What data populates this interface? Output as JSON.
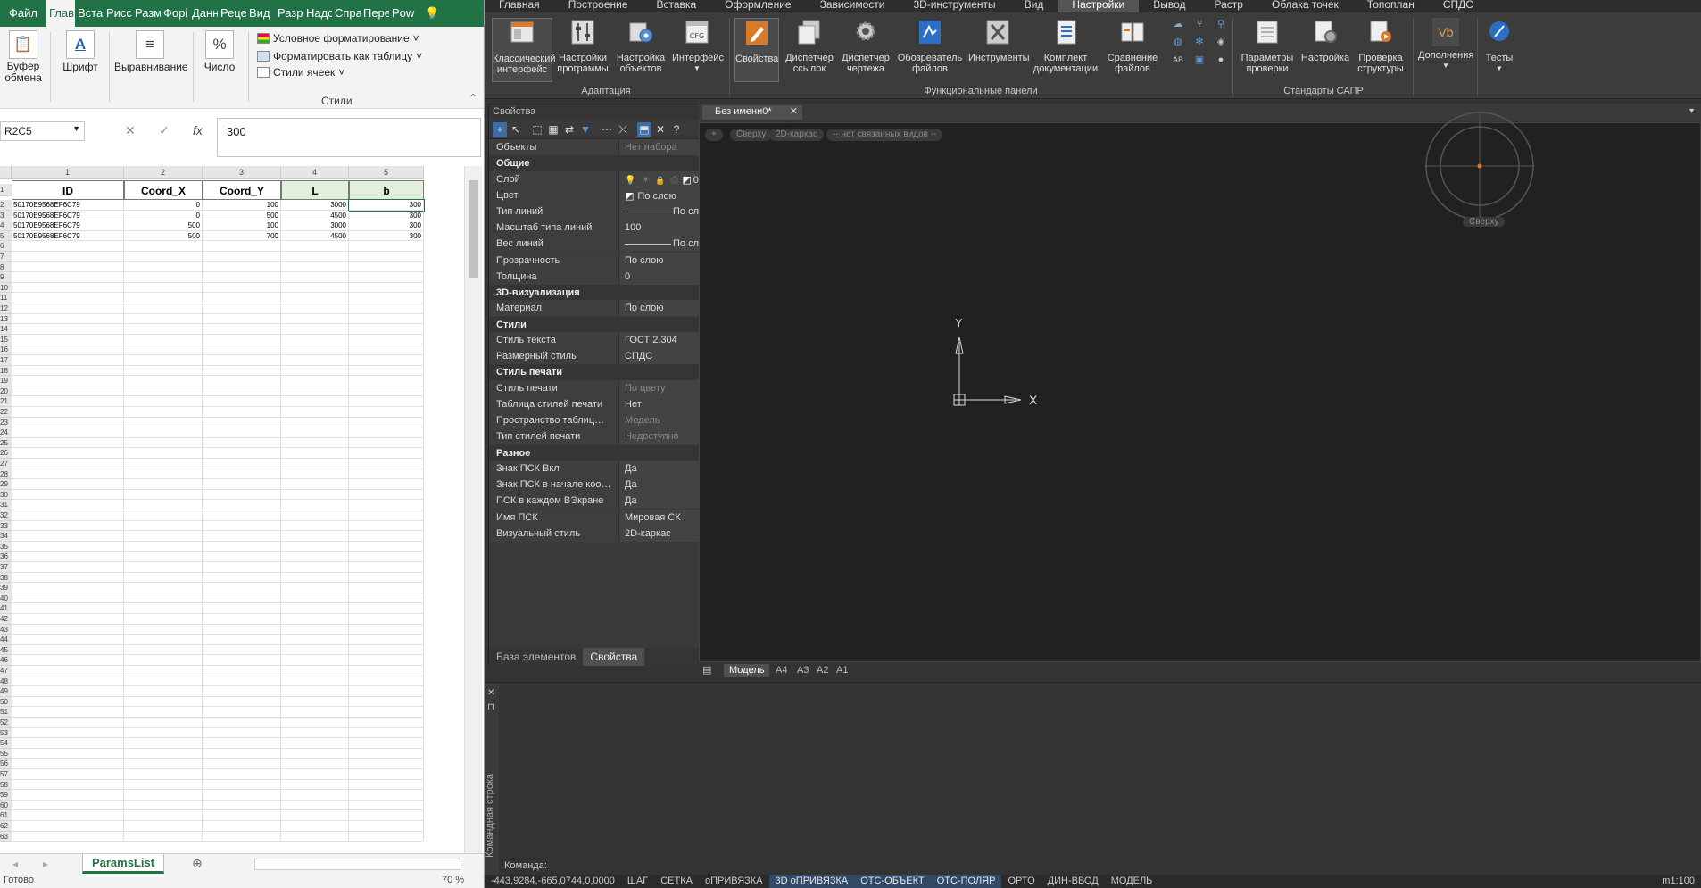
{
  "excel": {
    "tabs": [
      "Файл",
      "Глав",
      "Вста",
      "Рисс",
      "Разм",
      "Форі",
      "Данн",
      "Реце",
      "Вид",
      "Разр",
      "Надс",
      "Спра",
      "Пере",
      "Pow"
    ],
    "ribbon": {
      "clipboard": "Буфер обмена",
      "font": "Шрифт",
      "alignment": "Выравнивание",
      "number": "Число",
      "cond_format": "Условное форматирование",
      "format_table": "Форматировать как таблицу",
      "cell_styles": "Стили ячеек",
      "styles_group": "Стили"
    },
    "namebox": "R2C5",
    "formula_value": "300",
    "col_numbers": [
      "1",
      "2",
      "3",
      "4",
      "5"
    ],
    "headers": [
      "ID",
      "Coord_X",
      "Coord_Y",
      "L",
      "b"
    ],
    "rows": [
      [
        "50170E9568EF6C79",
        "0",
        "100",
        "3000",
        "300"
      ],
      [
        "50170E9568EF6C79",
        "0",
        "500",
        "4500",
        "300"
      ],
      [
        "50170E9568EF6C79",
        "500",
        "100",
        "3000",
        "300"
      ],
      [
        "50170E9568EF6C79",
        "500",
        "700",
        "4500",
        "300"
      ]
    ],
    "sheet_name": "ParamsList",
    "status_left": "Готово",
    "zoom": "70 %"
  },
  "cad": {
    "tabs": [
      "Главная",
      "Построение",
      "Вставка",
      "Оформление",
      "Зависимости",
      "3D-инструменты",
      "Вид",
      "Настройки",
      "Вывод",
      "Растр",
      "Облака точек",
      "Топоплан",
      "СПДС"
    ],
    "active_tab": "Настройки",
    "ribbon": {
      "classic_ui": "Классический интерфейс",
      "program_settings": "Настройки программы",
      "object_settings": "Настройка объектов",
      "interface": "Интерфейс",
      "group_adapt": "Адаптация",
      "properties": "Свойства",
      "link_manager": "Диспетчер ссылок",
      "drawing_manager": "Диспетчер чертежа",
      "file_browser": "Обозреватель файлов",
      "tools": "Инструменты",
      "doc_set": "Комплект документации",
      "compare_files": "Сравнение файлов",
      "group_func": "Функциональные панели",
      "check_params": "Параметры проверки",
      "setup": "Настройка",
      "check_struct": "Проверка структуры",
      "group_cad_std": "Стандарты САПР",
      "addons": "Дополнения",
      "tests": "Тесты",
      "vb_label": "Vb"
    },
    "props": {
      "title": "Свойства",
      "rows": [
        {
          "k": "Объекты",
          "v": "Нет набора",
          "dim": true
        },
        {
          "k": "Общие",
          "sect": true
        },
        {
          "k": "Слой",
          "v": "0",
          "layer": true
        },
        {
          "k": "Цвет",
          "v": "По слою",
          "swatch": true
        },
        {
          "k": "Тип линий",
          "v": "По слою",
          "line": true
        },
        {
          "k": "Масштаб типа линий",
          "v": "100"
        },
        {
          "k": "Вес линий",
          "v": "По слою",
          "line": true
        },
        {
          "k": "Прозрачность",
          "v": "По слою"
        },
        {
          "k": "Толщина",
          "v": "0"
        },
        {
          "k": "3D-визуализация",
          "sect": true
        },
        {
          "k": "Материал",
          "v": "По слою"
        },
        {
          "k": "Стили",
          "sect": true
        },
        {
          "k": "Стиль текста",
          "v": "ГОСТ 2.304"
        },
        {
          "k": "Размерный стиль",
          "v": "СПДС"
        },
        {
          "k": "Стиль печати",
          "sect": true
        },
        {
          "k": "Стиль печати",
          "v": "По цвету",
          "dim": true
        },
        {
          "k": "Таблица стилей печати",
          "v": "Нет"
        },
        {
          "k": "Пространство таблицы с...",
          "v": "Модель",
          "dim": true
        },
        {
          "k": "Тип стилей печати",
          "v": "Недоступно",
          "dim": true
        },
        {
          "k": "Разное",
          "sect": true
        },
        {
          "k": "Знак ПСК Вкл",
          "v": "Да"
        },
        {
          "k": "Знак ПСК в начале коор...",
          "v": "Да"
        },
        {
          "k": "ПСК в каждом ВЭкране",
          "v": "Да"
        },
        {
          "k": "Имя ПСК",
          "v": "Мировая СК"
        },
        {
          "k": "Визуальный стиль",
          "v": "2D-каркас"
        }
      ],
      "bottom_tabs": [
        "База элементов",
        "Свойства"
      ]
    },
    "doc_tab": "Без имени0*",
    "viewport": {
      "pills": [
        "+",
        "Сверху",
        "2D-каркас",
        "-- нет связанных видов --"
      ],
      "viewcube_label": "Сверху",
      "axis_y": "Y",
      "axis_x": "X"
    },
    "layout_tabs": [
      "Модель",
      "A4",
      "A3",
      "A2",
      "A1"
    ],
    "cmd_side": "Командная строка",
    "cmd_prompt": "Команда:",
    "status": {
      "coords": "-443,9284,-665,0744,0,0000",
      "items": [
        "ШАГ",
        "СЕТКА",
        "оПРИВЯЗКА",
        "3D оПРИВЯЗКА",
        "ОТС-ОБЪЕКТ",
        "ОТС-ПОЛЯР",
        "ОРТО",
        "ДИН-ВВОД",
        "МОДЕЛЬ"
      ],
      "on_items": [
        "3D оПРИВЯЗКА",
        "ОТС-ОБЪЕКТ",
        "ОТС-ПОЛЯР"
      ],
      "scale": "m1:100"
    }
  }
}
